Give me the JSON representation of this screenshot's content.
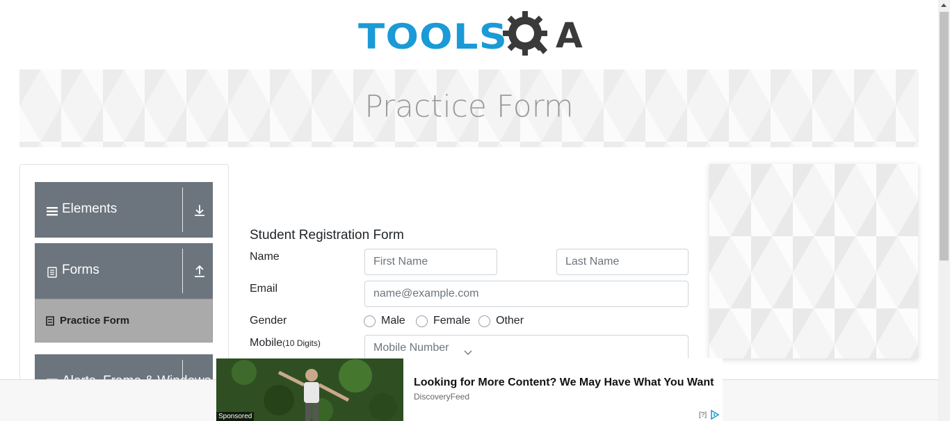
{
  "logo": {
    "text": "TOOLS",
    "suffix": "A"
  },
  "banner": {
    "title": "Practice Form"
  },
  "sidebar": {
    "groups": [
      {
        "label": "Elements",
        "icon": "hamburger-icon",
        "arrow": "download-arrow-icon"
      },
      {
        "label": "Forms",
        "icon": "document-icon",
        "arrow": "upload-arrow-icon"
      },
      {
        "label": "Alerts, Frame & Windows",
        "icon": "window-icon",
        "arrow": "download-arrow-icon"
      }
    ],
    "active_item": {
      "label": "Practice Form",
      "icon": "form-icon"
    }
  },
  "form": {
    "title": "Student Registration Form",
    "name_label": "Name",
    "first_name_placeholder": "First Name",
    "last_name_placeholder": "Last Name",
    "email_label": "Email",
    "email_placeholder": "name@example.com",
    "gender_label": "Gender",
    "gender_options": [
      "Male",
      "Female",
      "Other"
    ],
    "mobile_label": "Mobile",
    "mobile_hint": "(10 Digits)",
    "mobile_placeholder": "Mobile Number"
  },
  "ad": {
    "headline": "Looking for More Content? We May Have What You Want",
    "source": "DiscoveryFeed",
    "sponsored": "Sponsored",
    "info": "[?]"
  },
  "colors": {
    "accent": "#1a9ad7",
    "sidebar": "#6c757d",
    "active": "#aaaaaa"
  }
}
